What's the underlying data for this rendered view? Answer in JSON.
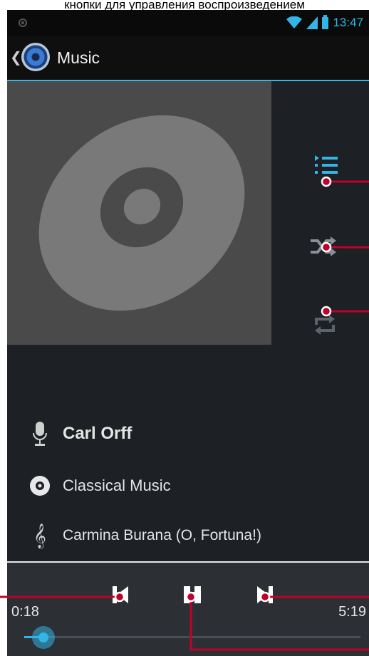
{
  "caption": "кнопки для управления воспроизведением",
  "status_bar": {
    "time": "13:47"
  },
  "action_bar": {
    "back_glyph": "❮",
    "title": "Music"
  },
  "icons": {
    "app": "music-disc-icon",
    "queue": "playlist-icon",
    "shuffle": "shuffle-icon",
    "repeat": "repeat-icon",
    "artist": "microphone-icon",
    "album": "album-disc-icon",
    "song": "treble-clef-icon",
    "prev": "previous-icon",
    "pause": "pause-icon",
    "next": "next-icon"
  },
  "track": {
    "artist": "Carl Orff",
    "album": "Classical Music",
    "song": "Carmina Burana (O, Fortuna!)",
    "song_glyph": "𝄞"
  },
  "playback": {
    "elapsed": "0:18",
    "total": "5:19",
    "progress": 0.058
  },
  "colors": {
    "accent": "#33b5e5",
    "annotation": "#c0002a",
    "background": "#1d2024"
  }
}
